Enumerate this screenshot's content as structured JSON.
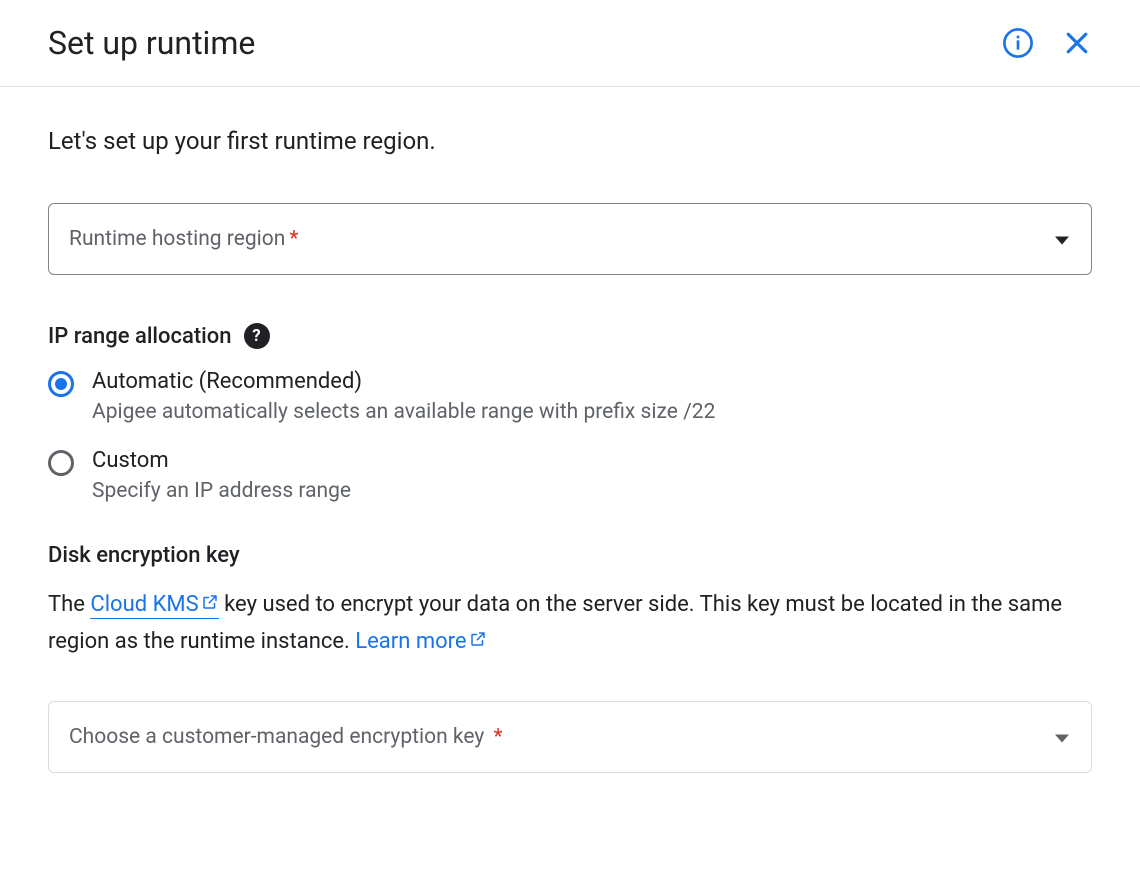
{
  "header": {
    "title": "Set up runtime"
  },
  "intro": "Let's set up your first runtime region.",
  "region_select": {
    "label": "Runtime hosting region",
    "required_mark": "*"
  },
  "ip_range": {
    "heading": "IP range allocation",
    "help_symbol": "?",
    "options": [
      {
        "label": "Automatic (Recommended)",
        "description": "Apigee automatically selects an available range with prefix size /22",
        "selected": true
      },
      {
        "label": "Custom",
        "description": "Specify an IP address range",
        "selected": false
      }
    ]
  },
  "encryption": {
    "heading": "Disk encryption key",
    "desc_prefix": "The ",
    "link1": "Cloud KMS",
    "desc_mid": " key used to encrypt your data on the server side. This key must be located in the same region as the runtime instance. ",
    "link2": "Learn more",
    "select_label": "Choose a customer-managed encryption key",
    "required_mark": "*"
  }
}
